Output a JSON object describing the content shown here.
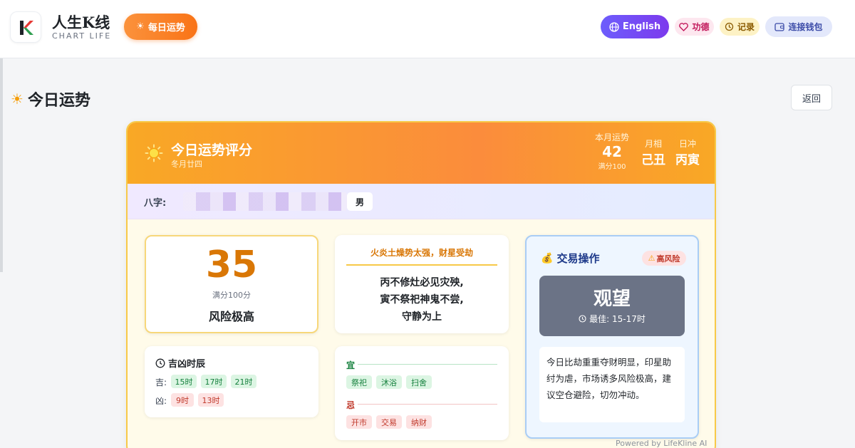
{
  "header": {
    "brand_title": "人生K线",
    "brand_subtitle": "CHART LIFE",
    "daily_label": "每日运势",
    "english_label": "English",
    "merit_label": "功德",
    "records_label": "记录",
    "wallet_label": "连接钱包"
  },
  "page": {
    "title": "今日运势",
    "back_label": "返回"
  },
  "card": {
    "title": "今日运势评分",
    "lunar_date": "冬月廿四",
    "month_fortune_label": "本月运势",
    "month_fortune_value": "42",
    "month_fortune_sub": "满分100",
    "moon_phase_label": "月相",
    "moon_phase_value": "己丑",
    "day_clash_label": "日冲",
    "day_clash_value": "丙寅",
    "bazi_label": "八字:",
    "gender": "男"
  },
  "score": {
    "value": "35",
    "sub": "满分100分",
    "level": "风险极高"
  },
  "quote": {
    "heading": "火炎土燥势太强，财星受劫",
    "lines": [
      "丙不修灶必见灾殃,",
      "寅不祭祀神鬼不尝,",
      "守静为上"
    ]
  },
  "trade": {
    "title": "交易操作",
    "risk_badge": "高风险",
    "action": "观望",
    "best_time": "最佳: 15-17时",
    "advice": "今日比劫重重夺财明显，印星助纣为虐，市场诱多风险极高，建议空仓避险，切勿冲动。"
  },
  "hours": {
    "title": "吉凶时辰",
    "good_label": "吉:",
    "good": [
      "15时",
      "17时",
      "21时"
    ],
    "bad_label": "凶:",
    "bad": [
      "9时",
      "13时"
    ]
  },
  "yiji": {
    "yi_label": "宜",
    "yi": [
      "祭祀",
      "沐浴",
      "扫舍"
    ],
    "ji_label": "忌",
    "ji": [
      "开市",
      "交易",
      "纳财"
    ]
  },
  "footer": {
    "powered": "Powered by LifeKline AI"
  },
  "colors": {
    "accent_orange": "#f97316",
    "header_gold": "#f9a825",
    "risk_red": "#c0392b",
    "good_green": "#15803d",
    "action_gray": "#6b7386"
  }
}
